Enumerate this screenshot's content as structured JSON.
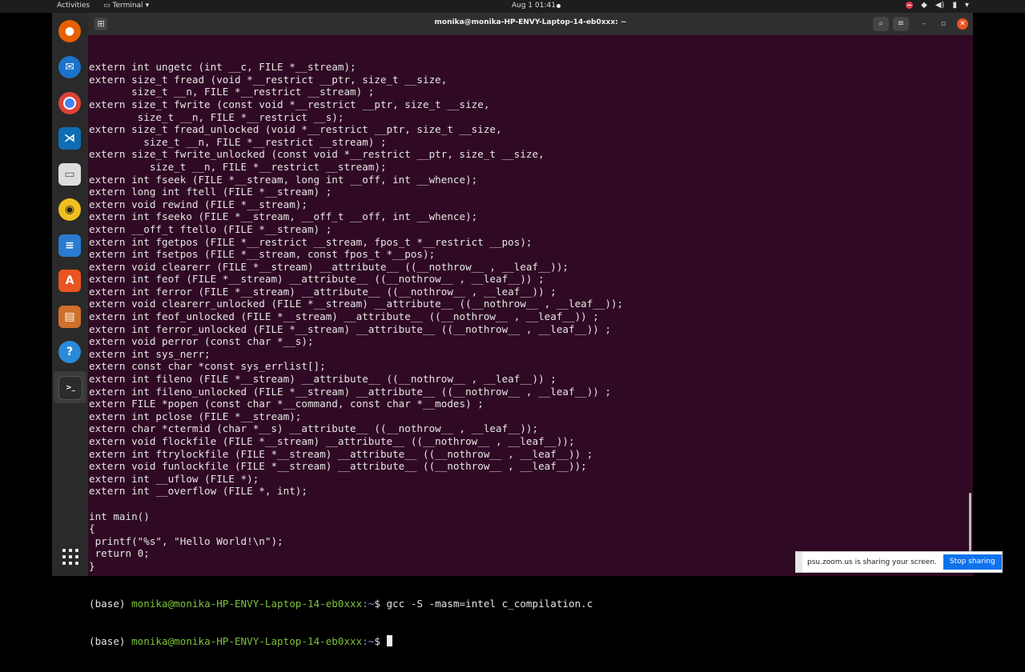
{
  "topbar": {
    "activities": "Activities",
    "app_menu": "Terminal",
    "clock": "Aug 1  01:41"
  },
  "dock": {
    "apps": [
      "firefox-icon",
      "thunderbird-icon",
      "chrome-icon",
      "vscode-icon",
      "files-icon",
      "rhythmbox-icon",
      "writer-icon",
      "software-icon",
      "impress-icon",
      "help-icon",
      "terminal-icon"
    ]
  },
  "window": {
    "title": "monika@monika-HP-ENVY-Laptop-14-eb0xxx: ~"
  },
  "terminal": {
    "lines": [
      "extern int ungetc (int __c, FILE *__stream);",
      "extern size_t fread (void *__restrict __ptr, size_t __size,",
      "       size_t __n, FILE *__restrict __stream) ;",
      "extern size_t fwrite (const void *__restrict __ptr, size_t __size,",
      "        size_t __n, FILE *__restrict __s);",
      "extern size_t fread_unlocked (void *__restrict __ptr, size_t __size,",
      "         size_t __n, FILE *__restrict __stream) ;",
      "extern size_t fwrite_unlocked (const void *__restrict __ptr, size_t __size,",
      "          size_t __n, FILE *__restrict __stream);",
      "extern int fseek (FILE *__stream, long int __off, int __whence);",
      "extern long int ftell (FILE *__stream) ;",
      "extern void rewind (FILE *__stream);",
      "extern int fseeko (FILE *__stream, __off_t __off, int __whence);",
      "extern __off_t ftello (FILE *__stream) ;",
      "extern int fgetpos (FILE *__restrict __stream, fpos_t *__restrict __pos);",
      "extern int fsetpos (FILE *__stream, const fpos_t *__pos);",
      "extern void clearerr (FILE *__stream) __attribute__ ((__nothrow__ , __leaf__));",
      "extern int feof (FILE *__stream) __attribute__ ((__nothrow__ , __leaf__)) ;",
      "extern int ferror (FILE *__stream) __attribute__ ((__nothrow__ , __leaf__)) ;",
      "extern void clearerr_unlocked (FILE *__stream) __attribute__ ((__nothrow__ , __leaf__));",
      "extern int feof_unlocked (FILE *__stream) __attribute__ ((__nothrow__ , __leaf__)) ;",
      "extern int ferror_unlocked (FILE *__stream) __attribute__ ((__nothrow__ , __leaf__)) ;",
      "extern void perror (const char *__s);",
      "extern int sys_nerr;",
      "extern const char *const sys_errlist[];",
      "extern int fileno (FILE *__stream) __attribute__ ((__nothrow__ , __leaf__)) ;",
      "extern int fileno_unlocked (FILE *__stream) __attribute__ ((__nothrow__ , __leaf__)) ;",
      "extern FILE *popen (const char *__command, const char *__modes) ;",
      "extern int pclose (FILE *__stream);",
      "extern char *ctermid (char *__s) __attribute__ ((__nothrow__ , __leaf__));",
      "extern void flockfile (FILE *__stream) __attribute__ ((__nothrow__ , __leaf__));",
      "extern int ftrylockfile (FILE *__stream) __attribute__ ((__nothrow__ , __leaf__)) ;",
      "extern void funlockfile (FILE *__stream) __attribute__ ((__nothrow__ , __leaf__));",
      "extern int __uflow (FILE *);",
      "extern int __overflow (FILE *, int);",
      "",
      "int main()",
      "{",
      " printf(\"%s\", \"Hello World!\\n\");",
      " return 0;",
      "}"
    ],
    "prompt_prefix": "(base) ",
    "prompt_user": "monika@monika-HP-ENVY-Laptop-14-eb0xxx",
    "prompt_path": ":~",
    "prompt_sign": "$ ",
    "command": "gcc -S -masm=intel c_compilation.c",
    "current_input": ""
  },
  "zoom_banner": {
    "message": "psu.zoom.us is sharing your screen.",
    "stop_label": "Stop sharing"
  },
  "colors": {
    "terminal_bg": "#300a24",
    "prompt_user": "#7ec13a",
    "prompt_path": "#7aa6da",
    "ubuntu_orange": "#e95420",
    "zoom_blue": "#0e72ed"
  }
}
